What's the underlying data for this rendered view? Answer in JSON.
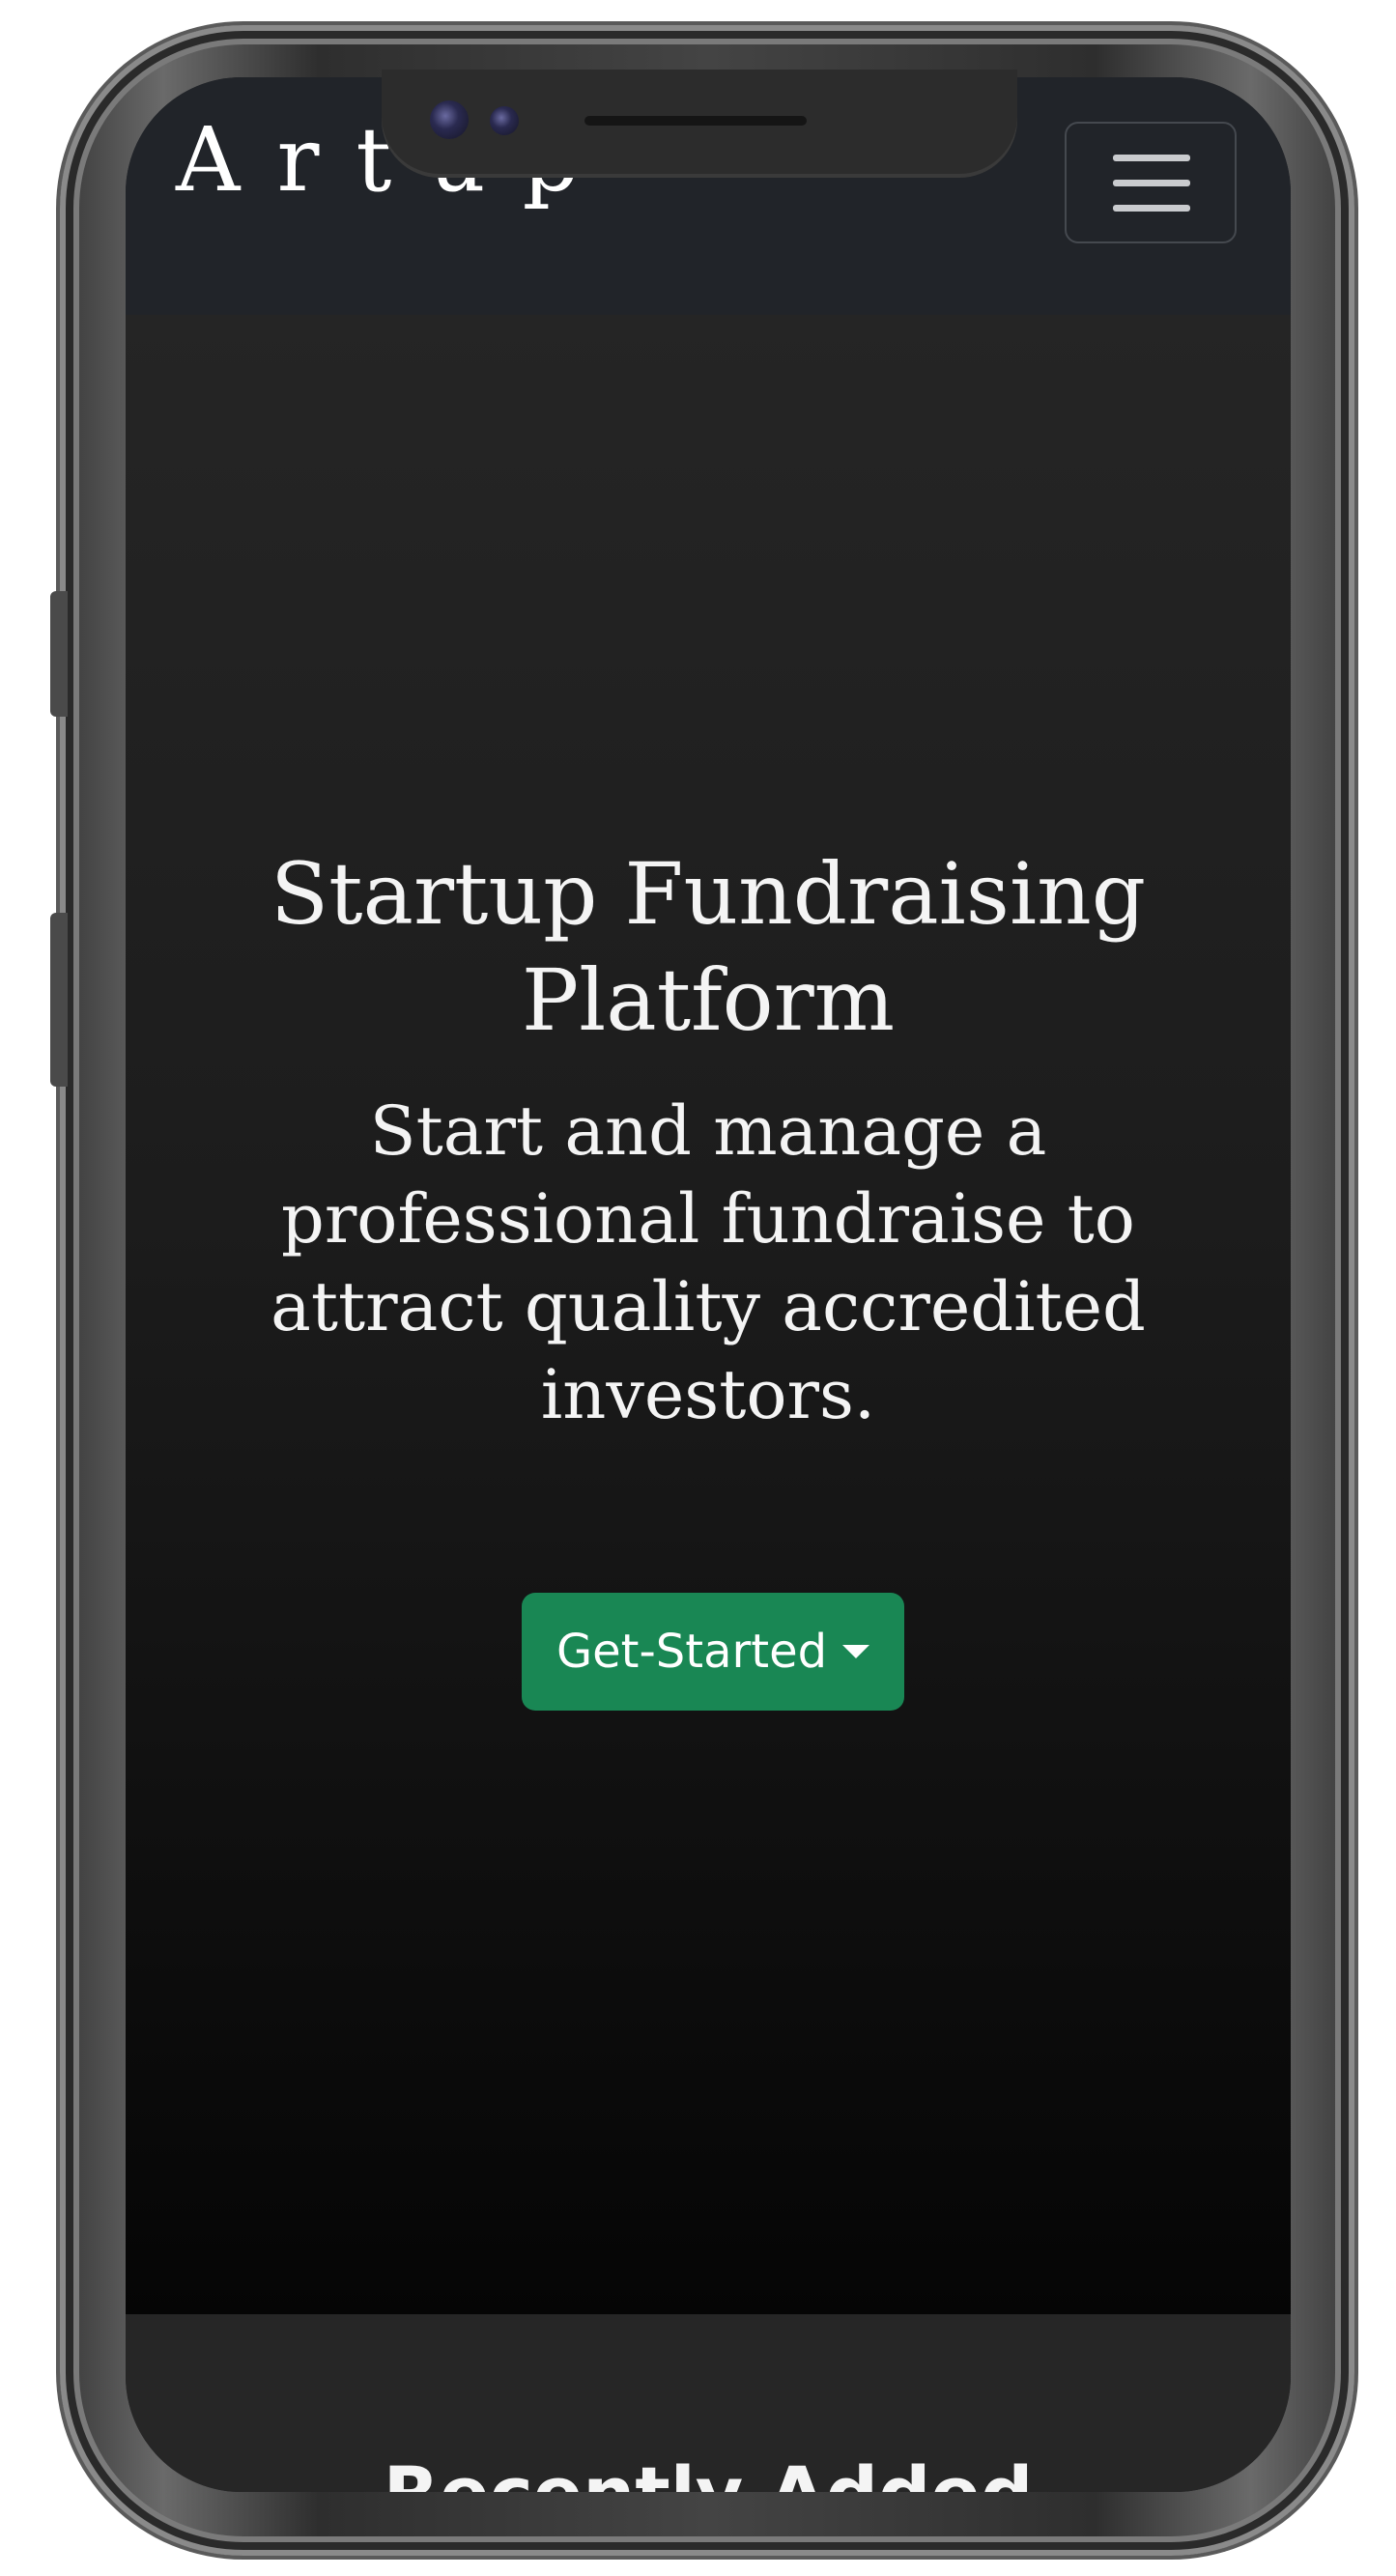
{
  "navbar": {
    "brand": "Artup",
    "menu_button": "hamburger-menu"
  },
  "hero": {
    "title": "Startup Fundraising Platform",
    "subtitle": "Start and manage a professional fundraise to attract quality accredited investors.",
    "cta_label": "Get-Started",
    "cta_color": "#198754"
  },
  "next_section": {
    "title": "Recently Added"
  },
  "colors": {
    "navbar_bg": "#212429",
    "hero_text": "#f4f4f4",
    "page_bg": "#222326"
  }
}
